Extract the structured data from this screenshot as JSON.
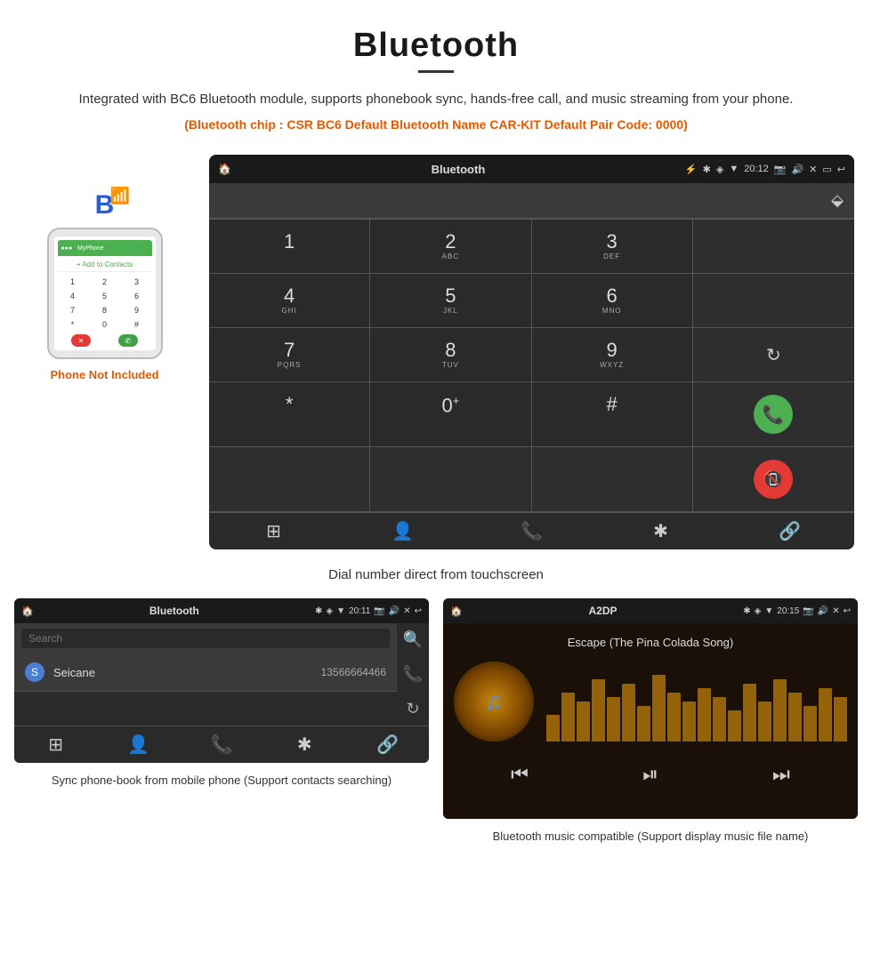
{
  "header": {
    "title": "Bluetooth",
    "subtitle": "Integrated with BC6 Bluetooth module, supports phonebook sync, hands-free call, and music streaming from your phone.",
    "specs": "(Bluetooth chip : CSR BC6    Default Bluetooth Name CAR-KIT    Default Pair Code: 0000)"
  },
  "dial_screen": {
    "statusbar": {
      "left_icon": "🏠",
      "center": "Bluetooth",
      "usb_icon": "⚡",
      "bt_icon": "✱",
      "location_icon": "◈",
      "signal_icon": "▼",
      "time": "20:12",
      "camera_icon": "📷",
      "volume_icon": "🔊",
      "close_icon": "✕",
      "window_icon": "▭",
      "back_icon": "↩"
    },
    "keys": [
      {
        "main": "1",
        "sub": ""
      },
      {
        "main": "2",
        "sub": "ABC"
      },
      {
        "main": "3",
        "sub": "DEF"
      },
      {
        "main": "",
        "sub": "",
        "type": "empty"
      },
      {
        "main": "4",
        "sub": "GHI"
      },
      {
        "main": "5",
        "sub": "JKL"
      },
      {
        "main": "6",
        "sub": "MNO"
      },
      {
        "main": "",
        "sub": "",
        "type": "empty"
      },
      {
        "main": "7",
        "sub": "PQRS"
      },
      {
        "main": "8",
        "sub": "TUV"
      },
      {
        "main": "9",
        "sub": "WXYZ"
      },
      {
        "main": "",
        "sub": "",
        "type": "refresh"
      },
      {
        "main": "*",
        "sub": ""
      },
      {
        "main": "0",
        "sub": "+"
      },
      {
        "main": "#",
        "sub": ""
      },
      {
        "main": "",
        "sub": "",
        "type": "call-green"
      },
      {
        "main": "",
        "sub": "",
        "type": "call-red"
      }
    ],
    "nav_icons": [
      "⊞",
      "👤",
      "📞",
      "✱",
      "🔗"
    ]
  },
  "dial_caption": "Dial number direct from touchscreen",
  "phonebook_screen": {
    "statusbar_left": "🏠",
    "statusbar_center": "Bluetooth",
    "statusbar_time": "20:11",
    "search_placeholder": "Search",
    "contact_letter": "S",
    "contact_name": "Seicane",
    "contact_number": "13566664466",
    "side_icons": [
      "🔍",
      "📞",
      "↻"
    ],
    "nav_icons": [
      "⊞",
      "👤",
      "📞",
      "✱",
      "🔗"
    ]
  },
  "music_screen": {
    "statusbar_left": "🏠",
    "statusbar_center": "A2DP",
    "statusbar_time": "20:15",
    "song_title": "Escape (The Pina Colada Song)",
    "eq_bars": [
      30,
      55,
      45,
      70,
      50,
      65,
      40,
      75,
      55,
      45,
      60,
      50,
      35,
      65,
      45,
      70,
      55,
      40,
      60,
      50
    ],
    "ctrl_icons": [
      "⏮",
      "⏯",
      "⏭"
    ]
  },
  "phone_not_included": "Phone Not Included",
  "bottom_captions": {
    "left": "Sync phone-book from mobile phone\n(Support contacts searching)",
    "right": "Bluetooth music compatible\n(Support display music file name)"
  }
}
